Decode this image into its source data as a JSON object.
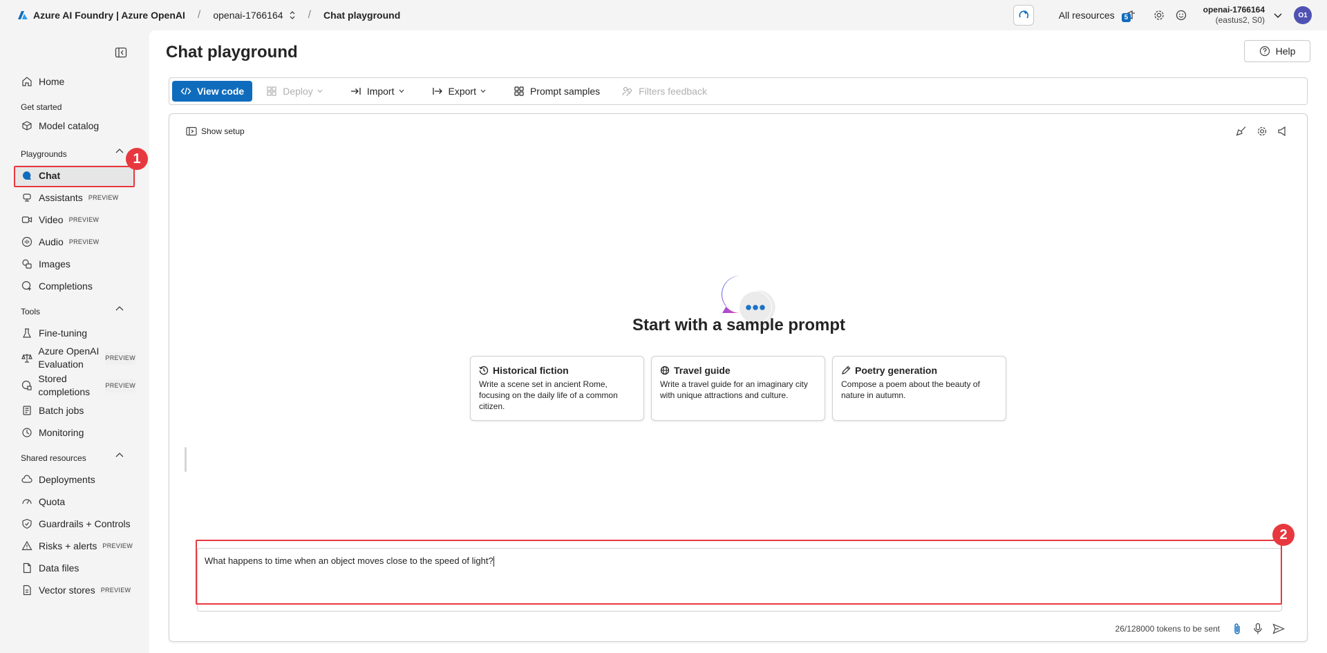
{
  "header": {
    "brand": "Azure AI Foundry | Azure OpenAI",
    "resource": "openai-1766164",
    "current_page": "Chat playground",
    "all_resources": "All resources",
    "notif_count": "5",
    "account_name": "openai-1766164",
    "account_region": "(eastus2, S0)",
    "avatar_initials": "O1"
  },
  "sidebar": {
    "home": "Home",
    "get_started": "Get started",
    "model_catalog": "Model catalog",
    "playgrounds": "Playgrounds",
    "chat": "Chat",
    "assistants": "Assistants",
    "video": "Video",
    "audio": "Audio",
    "images": "Images",
    "completions": "Completions",
    "tools": "Tools",
    "fine_tuning": "Fine-tuning",
    "evaluation_1": "Azure OpenAI",
    "evaluation_2": "Evaluation",
    "stored_1": "Stored",
    "stored_2": "completions",
    "batch_jobs": "Batch jobs",
    "monitoring": "Monitoring",
    "shared_resources": "Shared resources",
    "deployments": "Deployments",
    "quota": "Quota",
    "guardrails": "Guardrails + Controls",
    "risks": "Risks + alerts",
    "data_files": "Data files",
    "vector_stores": "Vector stores",
    "preview": "PREVIEW"
  },
  "main": {
    "title": "Chat playground",
    "help": "Help",
    "toolbar": {
      "view_code": "View code",
      "deploy": "Deploy",
      "import": "Import",
      "export": "Export",
      "prompt_samples": "Prompt samples",
      "filters_feedback": "Filters feedback"
    },
    "show_setup": "Show setup",
    "start_title": "Start with a sample prompt",
    "cards": [
      {
        "title": "Historical fiction",
        "desc": "Write a scene set in ancient Rome, focusing on the daily life of a common citizen."
      },
      {
        "title": "Travel guide",
        "desc": "Write a travel guide for an imaginary city with unique attractions and culture."
      },
      {
        "title": "Poetry generation",
        "desc": "Compose a poem about the beauty of nature in autumn."
      }
    ],
    "input_value": "What happens to time when an object moves close to the speed of light?",
    "tokens": "26/128000 tokens to be sent"
  },
  "annotations": [
    "1",
    "2"
  ],
  "colors": {
    "accent": "#0f6cbd",
    "annotation": "#e8383f"
  }
}
